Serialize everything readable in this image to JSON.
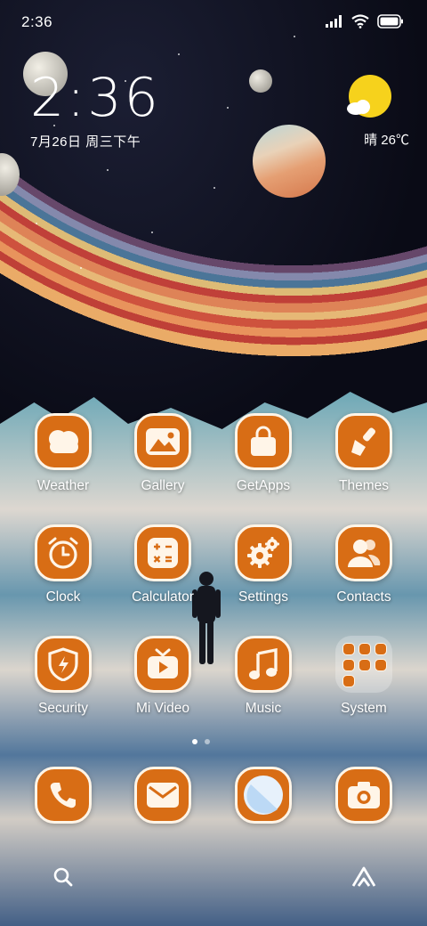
{
  "status_bar": {
    "time": "2:36",
    "icons": [
      "signal-icon",
      "wifi-icon",
      "battery-icon"
    ]
  },
  "clock_widget": {
    "time": "2:36",
    "date": "7月26日 周三下午"
  },
  "weather_widget": {
    "condition_temp": "晴 26℃",
    "icon": "sunny-partly-cloudy-icon"
  },
  "apps": {
    "row1": [
      {
        "label": "Weather",
        "icon": "weather-cloud-icon"
      },
      {
        "label": "Gallery",
        "icon": "gallery-mountain-icon"
      },
      {
        "label": "GetApps",
        "icon": "shopping-bag-icon"
      },
      {
        "label": "Themes",
        "icon": "paintbrush-icon"
      }
    ],
    "row2": [
      {
        "label": "Clock",
        "icon": "alarm-clock-icon"
      },
      {
        "label": "Calculator",
        "icon": "calculator-icon"
      },
      {
        "label": "Settings",
        "icon": "gear-icon"
      },
      {
        "label": "Contacts",
        "icon": "contacts-icon"
      }
    ],
    "row3": [
      {
        "label": "Security",
        "icon": "shield-icon"
      },
      {
        "label": "Mi Video",
        "icon": "tv-play-icon"
      },
      {
        "label": "Music",
        "icon": "music-note-icon"
      },
      {
        "label": "System",
        "icon": "folder-icon"
      }
    ]
  },
  "dock": [
    {
      "icon": "phone-icon"
    },
    {
      "icon": "mail-icon"
    },
    {
      "icon": "browser-icon"
    },
    {
      "icon": "camera-icon"
    }
  ],
  "page_indicator": {
    "pages": 2,
    "current": 1
  },
  "bottom_bar": {
    "left_icon": "search-icon",
    "right_icon": "app-vault-icon"
  },
  "colors": {
    "icon_bg": "#d86d15",
    "icon_fg": "#fff5e8"
  }
}
